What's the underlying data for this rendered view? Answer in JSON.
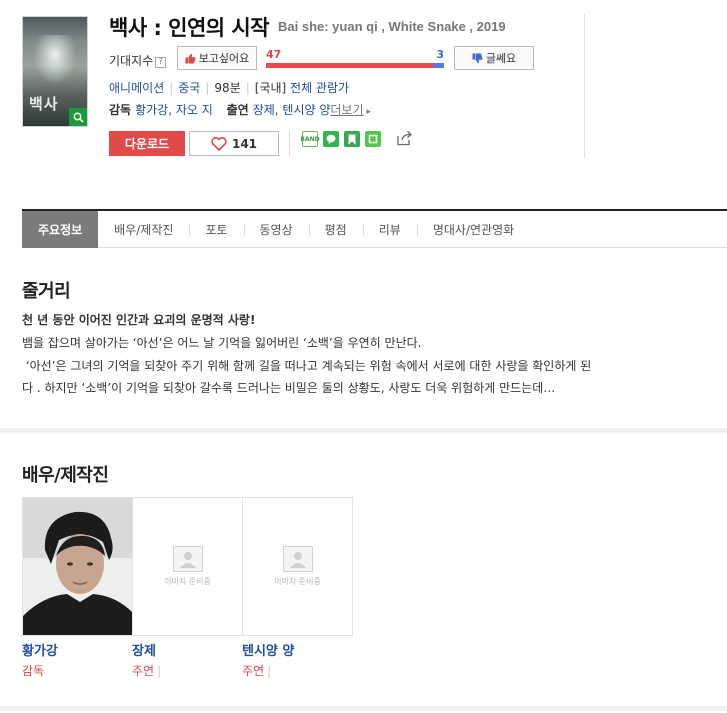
{
  "header": {
    "title": "백사 : 인연의 시작",
    "original_title": "Bai she: yuan qi , White Snake , 2019",
    "expect_label": "기대지수",
    "help_mark": "?",
    "want_label": "보고싶어요",
    "want_count": "47",
    "hmm_label": "글쎄요",
    "hmm_count": "3",
    "want_ratio": 0.94,
    "genre": "애니메이션",
    "country": "중국",
    "runtime": "98분",
    "rating_prefix": "[국내]",
    "rating": "전체 관람가",
    "director_label": "감독",
    "directors": "황가강, 자오 지",
    "cast_label": "출연",
    "cast": "장제, 텐시양 양",
    "more_label": "더보기",
    "download_label": "다운로드",
    "like_count": "141",
    "poster_title": "백사"
  },
  "tabs": [
    {
      "label": "주요정보",
      "active": true
    },
    {
      "label": "배우/제작진",
      "active": false
    },
    {
      "label": "포토",
      "active": false
    },
    {
      "label": "동영상",
      "active": false
    },
    {
      "label": "평점",
      "active": false
    },
    {
      "label": "리뷰",
      "active": false
    },
    {
      "label": "명대사/연관영화",
      "active": false
    }
  ],
  "synopsis": {
    "heading": "줄거리",
    "tagline": "천 년 동안 이어진 인간과 요괴의 운명적 사랑!",
    "lines": [
      "뱀을 잡으며 살아가는 ‘아선’은 어느 날 기억을 잃어버린 ‘소백’을 우연히 만난다.",
      " ‘아선’은 그녀의 기억을 되찾아 주기 위해 함께 길을 떠나고 계속되는 위험 속에서 서로에 대한 사랑을 확인하게 된",
      "다 . 하지만 ‘소백’이 기억을 되찾아 갈수록 드러나는 비밀은 둘의 상황도, 사랑도 더욱 위험하게 만드는데…"
    ]
  },
  "crew": {
    "heading": "배우/제작진",
    "no_image_text": "이미지 준비중",
    "people": [
      {
        "name": "황가강",
        "role": "감독",
        "has_photo": true
      },
      {
        "name": "장제",
        "role": "주연",
        "has_photo": false
      },
      {
        "name": "텐시양 양",
        "role": "주연",
        "has_photo": false
      }
    ]
  },
  "colors": {
    "accent_red": "#e24a4a",
    "link_blue": "#1f4fa0",
    "bar_blue": "#4d7be6"
  }
}
